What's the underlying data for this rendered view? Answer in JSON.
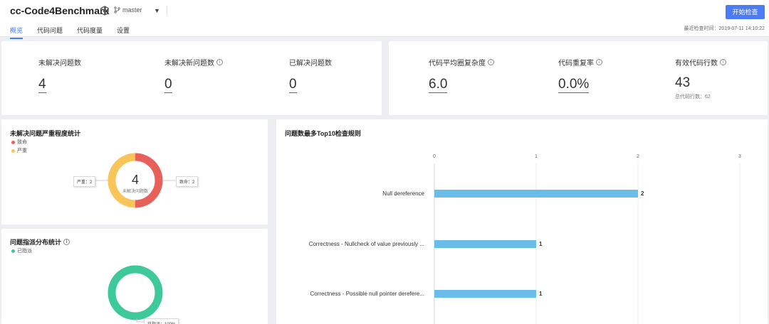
{
  "header": {
    "repo_title": "cc-Code4Benchmark",
    "branch": "master",
    "start_button": "开始检查",
    "last_check": "最近检查时间：2019-07-11 14:10:22",
    "tabs": [
      {
        "label": "概览"
      },
      {
        "label": "代码问题"
      },
      {
        "label": "代码度量"
      },
      {
        "label": "设置"
      }
    ]
  },
  "issues_summary": {
    "unresolved": {
      "label": "未解决问题数",
      "value": "4"
    },
    "unresolved_new": {
      "label": "未解决新问题数",
      "value": "0"
    },
    "resolved": {
      "label": "已解决问题数",
      "value": "0"
    }
  },
  "code_metrics": {
    "complexity": {
      "label": "代码平均圈复杂度",
      "value": "6.0"
    },
    "duplication": {
      "label": "代码重复率",
      "value": "0.0%"
    },
    "effective_lines": {
      "label": "有效代码行数",
      "value": "43",
      "sub": "总代码行数：62"
    }
  },
  "severity_card": {
    "title": "未解决问题严重程度统计",
    "legend": [
      {
        "label": "致命",
        "color": "#e8605a"
      },
      {
        "label": "严重",
        "color": "#f7c55a"
      }
    ],
    "center_value": "4",
    "center_label": "未解决问题数",
    "tip_left": "严重：2",
    "tip_right": "致命：2",
    "chart_data": {
      "type": "pie",
      "categories": [
        "致命",
        "严重"
      ],
      "values": [
        2,
        2
      ]
    }
  },
  "assign_card": {
    "title": "问题指派分布统计",
    "legend": [
      {
        "label": "已指派",
        "color": "#3ec99a"
      }
    ],
    "tip": "已指派：100%",
    "chart_data": {
      "type": "pie",
      "categories": [
        "已指派"
      ],
      "values": [
        100
      ]
    }
  },
  "top_rules_card": {
    "title": "问题数最多Top10检查规则",
    "bar_color": "#6bbde9",
    "chart_data": {
      "type": "bar",
      "orientation": "horizontal",
      "categories": [
        "Null dereference",
        "Correctness - Nullcheck of value previously ...",
        "Correctness - Possible null pointer derefere..."
      ],
      "values": [
        2,
        1,
        1
      ],
      "x_ticks": [
        "0",
        "1",
        "2",
        "3"
      ],
      "xlim": [
        0,
        3
      ]
    }
  }
}
